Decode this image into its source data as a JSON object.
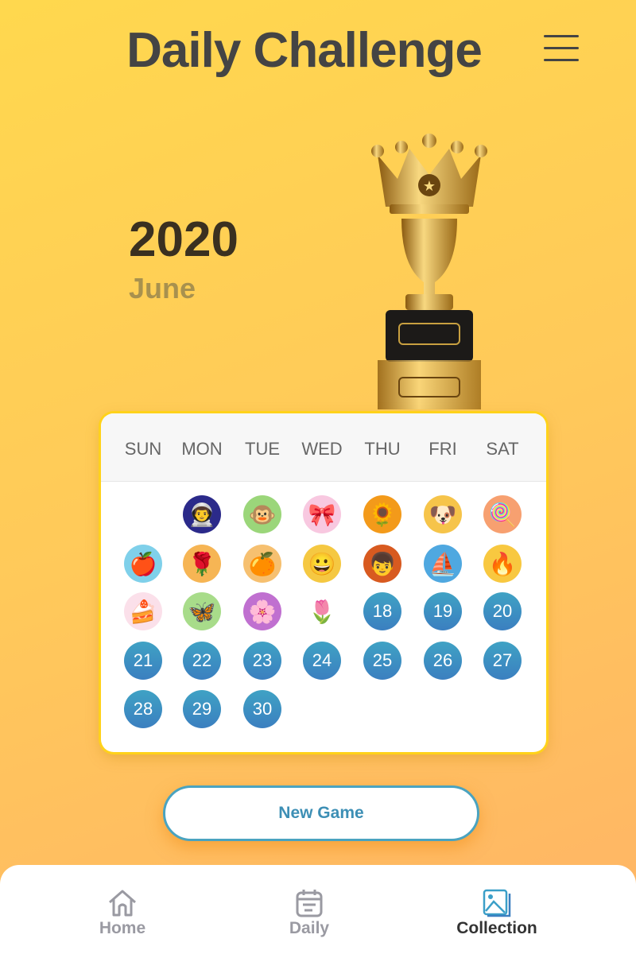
{
  "header": {
    "title": "Daily Challenge",
    "menu_icon": "hamburger-menu-icon"
  },
  "date": {
    "year": "2020",
    "month": "June"
  },
  "trophy_icon": "crown-trophy-icon",
  "calendar": {
    "weekdays": [
      "SUN",
      "MON",
      "TUE",
      "WED",
      "THU",
      "FRI",
      "SAT"
    ],
    "first_weekday_index": 1,
    "completed": [
      {
        "day": 1,
        "icon": "astronaut",
        "glyph": "👨‍🚀",
        "bg": "#2b2a8a"
      },
      {
        "day": 2,
        "icon": "monkey",
        "glyph": "🐵",
        "bg": "#9bd67a"
      },
      {
        "day": 3,
        "icon": "kimono-girl",
        "glyph": "🎀",
        "bg": "#f8c8e0"
      },
      {
        "day": 4,
        "icon": "sunflower",
        "glyph": "🌻",
        "bg": "#f39a1a"
      },
      {
        "day": 5,
        "icon": "bulldog",
        "glyph": "🐶",
        "bg": "#f6c44a"
      },
      {
        "day": 6,
        "icon": "candy",
        "glyph": "🍭",
        "bg": "#f7a070"
      },
      {
        "day": 7,
        "icon": "apple",
        "glyph": "🍎",
        "bg": "#7fd0ea"
      },
      {
        "day": 8,
        "icon": "roses",
        "glyph": "🌹",
        "bg": "#f6b554"
      },
      {
        "day": 9,
        "icon": "persimmons",
        "glyph": "🍊",
        "bg": "#f6c070"
      },
      {
        "day": 10,
        "icon": "smiley",
        "glyph": "😀",
        "bg": "#f5c842"
      },
      {
        "day": 11,
        "icon": "red-hair-boy",
        "glyph": "👦",
        "bg": "#d85a20"
      },
      {
        "day": 12,
        "icon": "iceberg",
        "glyph": "⛵",
        "bg": "#4fa8e0"
      },
      {
        "day": 13,
        "icon": "fire",
        "glyph": "🔥",
        "bg": "#f8c840"
      },
      {
        "day": 14,
        "icon": "cake",
        "glyph": "🍰",
        "bg": "#fbe0ea"
      },
      {
        "day": 15,
        "icon": "butterfly",
        "glyph": "🦋",
        "bg": "#a8dc8a"
      },
      {
        "day": 16,
        "icon": "tiles",
        "glyph": "🌸",
        "bg": "#c070d0"
      },
      {
        "day": 17,
        "icon": "pink-flower",
        "glyph": "🌷",
        "bg": "#ffffff"
      }
    ],
    "days_in_month": 30,
    "open_color": "#3b8fc2"
  },
  "new_game_label": "New Game",
  "tabs": [
    {
      "label": "Home",
      "icon": "home-icon",
      "active": false
    },
    {
      "label": "Daily",
      "icon": "calendar-icon",
      "active": false
    },
    {
      "label": "Collection",
      "icon": "gallery-icon",
      "active": true
    }
  ],
  "colors": {
    "accent": "#3d8fb5",
    "card_border": "#ffd21a"
  }
}
